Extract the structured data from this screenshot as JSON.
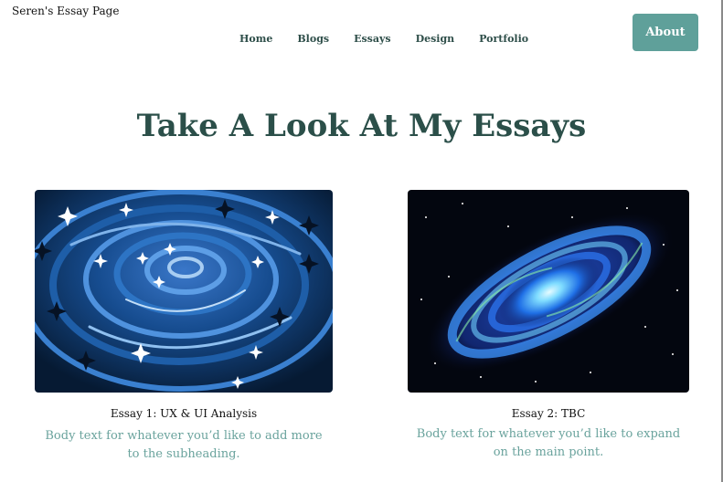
{
  "site": {
    "title": "Seren's Essay Page"
  },
  "nav": {
    "items": [
      {
        "label": "Home"
      },
      {
        "label": "Blogs"
      },
      {
        "label": "Essays"
      },
      {
        "label": "Design"
      },
      {
        "label": "Portfolio"
      }
    ],
    "about_label": "About"
  },
  "main": {
    "heading": "Take A Look At My Essays",
    "cards": [
      {
        "image": "swirling-starry-sky-painting",
        "title": "Essay 1: UX & UI Analysis",
        "body": "Body text for whatever you’d like to add more to the subheading."
      },
      {
        "image": "spiral-galaxy-photo",
        "title": "Essay 2: TBC",
        "body": "Body text for whatever you’d like to expand on the main point."
      }
    ]
  },
  "colors": {
    "accent": "#5fa09a",
    "heading": "#2b4f49",
    "nav_text": "#2f4f4a",
    "body_text": "#6aa39d"
  }
}
